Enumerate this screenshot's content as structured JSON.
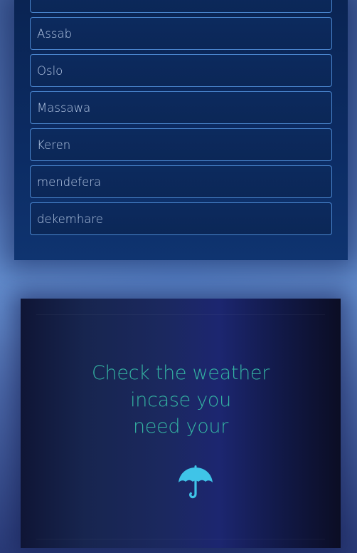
{
  "cities": {
    "items": [
      {
        "label": ""
      },
      {
        "label": "Assab"
      },
      {
        "label": "Oslo"
      },
      {
        "label": "Massawa"
      },
      {
        "label": "Keren"
      },
      {
        "label": "mendefera"
      },
      {
        "label": "dekemhare"
      }
    ]
  },
  "promo": {
    "line1": "Check the weather",
    "line2": "incase you",
    "line3": "need your",
    "icon": "umbrella-icon",
    "text_color": "#34b3a2",
    "icon_color": "#3fc4e8"
  },
  "colors": {
    "list_background": "#0b2a5e",
    "item_border": "#4a86cf",
    "item_text": "#b6c9e6"
  }
}
